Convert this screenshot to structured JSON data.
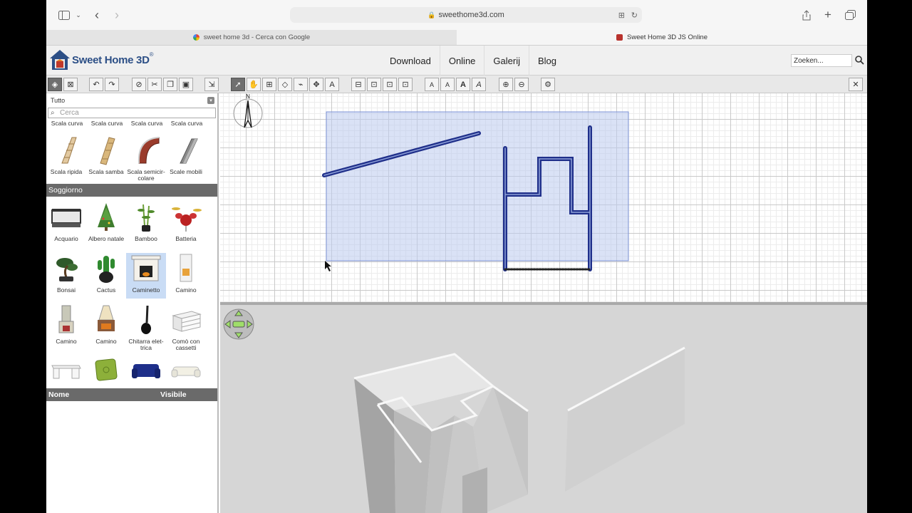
{
  "browser": {
    "url": "sweethome3d.com",
    "tabs": [
      {
        "label": "sweet home 3d - Cerca con Google",
        "active": false
      },
      {
        "label": "Sweet Home 3D JS Online",
        "active": true
      }
    ]
  },
  "site": {
    "logo_text": "Sweet Home 3D",
    "logo_mark": "®",
    "nav": [
      "Download",
      "Online",
      "Galerij",
      "Blog"
    ],
    "search_value": "Zoeken...",
    "search_icon": "magnifier-icon"
  },
  "catalog": {
    "category": "Tutto",
    "search_placeholder": "Cerca",
    "top_row_labels": [
      "Scala curva",
      "Scala curva",
      "Scala curva",
      "Scala curva"
    ],
    "stairs": [
      {
        "label": "Scala ripida",
        "icon": "stair-steep-icon"
      },
      {
        "label": "Scala samba",
        "icon": "stair-samba-icon"
      },
      {
        "label": "Scala semicir-colare",
        "icon": "stair-semicircular-icon"
      },
      {
        "label": "Scale mobili",
        "icon": "escalator-icon"
      }
    ],
    "section_title": "Soggiorno",
    "living_row1": [
      {
        "label": "Acquario",
        "icon": "aquarium-icon"
      },
      {
        "label": "Albero natale",
        "icon": "christmas-tree-icon"
      },
      {
        "label": "Bamboo",
        "icon": "bamboo-plant-icon"
      },
      {
        "label": "Batteria",
        "icon": "drum-kit-icon"
      }
    ],
    "living_row2": [
      {
        "label": "Bonsai",
        "icon": "bonsai-icon"
      },
      {
        "label": "Cactus",
        "icon": "cactus-icon"
      },
      {
        "label": "Caminetto",
        "icon": "fireplace-icon",
        "selected": true
      },
      {
        "label": "Camino",
        "icon": "fireplace-white-icon"
      }
    ],
    "living_row3": [
      {
        "label": "Camino",
        "icon": "chimney-icon"
      },
      {
        "label": "Camino",
        "icon": "hood-fireplace-icon"
      },
      {
        "label": "Chitarra elet-trica",
        "icon": "electric-guitar-icon"
      },
      {
        "label": "Comò con cassetti",
        "icon": "dresser-icon"
      }
    ]
  },
  "furniture_table": {
    "col_name": "Nome",
    "col_visible": "Visibile"
  },
  "plan": {
    "compass_letter": "N"
  },
  "colors": {
    "nav_header_bg": "#f0f0f0",
    "selection_blue": "#d5dcf5",
    "wall_blue": "#1f2f8a",
    "panel_header": "#6a6a6a",
    "view3d_bg": "#d6d6d6"
  }
}
